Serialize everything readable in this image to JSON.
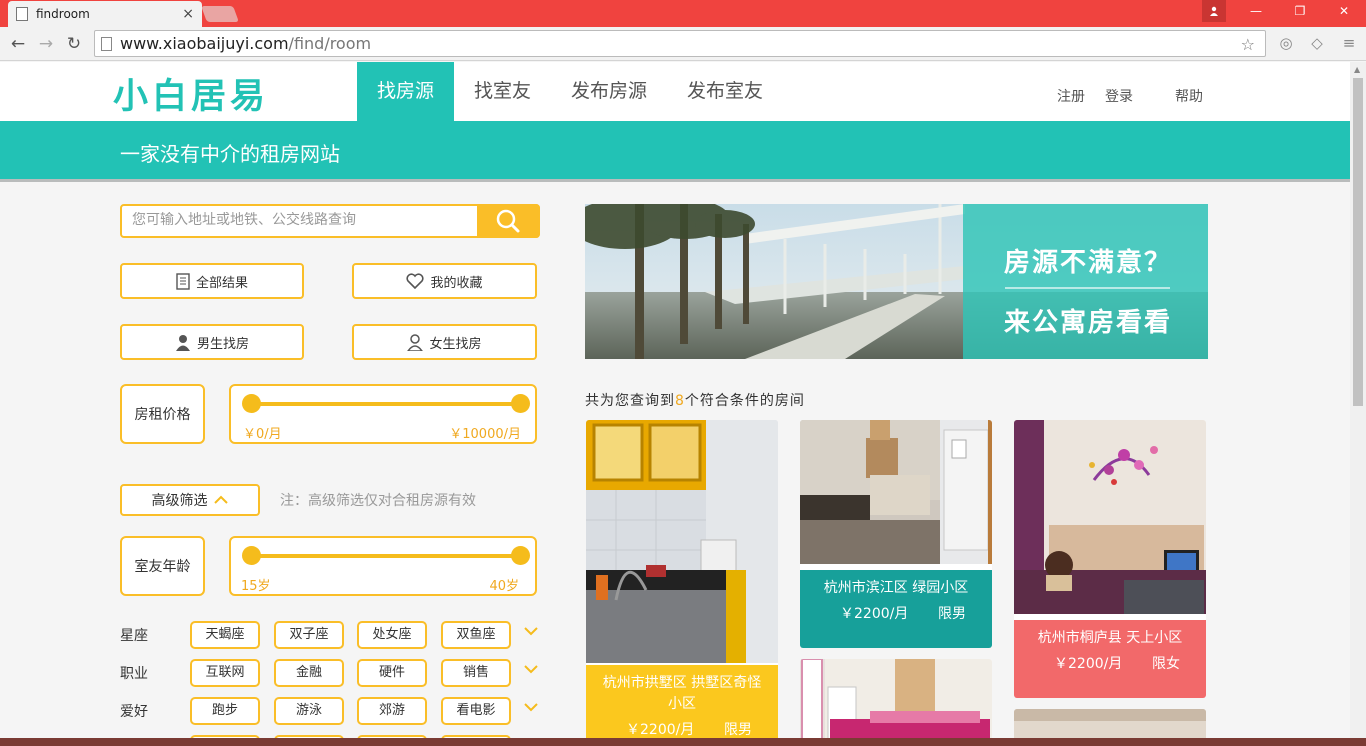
{
  "browser": {
    "tab_title": "findroom",
    "tab_close": "×",
    "url_host": "www.xiaobaijuyi.com",
    "url_path": "/find/room",
    "win_minimize": "—",
    "win_restore": "❐",
    "win_close": "✕"
  },
  "site": {
    "logo": "小白居易",
    "nav": [
      "找房源",
      "找室友",
      "发布房源",
      "发布室友"
    ],
    "register": "注册",
    "login": "登录",
    "help": "帮助",
    "tagline": "一家没有中介的租房网站"
  },
  "filters": {
    "search_placeholder": "您可输入地址或地铁、公交线路查询",
    "all_results": "全部结果",
    "my_favorites": "我的收藏",
    "male_search": "男生找房",
    "female_search": "女生找房",
    "rent_label": "房租价格",
    "rent_min": "￥0/月",
    "rent_max": "￥10000/月",
    "rent_low_fraction": 0,
    "rent_high_fraction": 1,
    "advanced": "高级筛选",
    "advanced_note": "注：高级筛选仅对合租房源有效",
    "age_label": "室友年龄",
    "age_min": "15岁",
    "age_max": "40岁",
    "rows": [
      {
        "label": "星座",
        "chips": [
          "天蝎座",
          "双子座",
          "处女座",
          "双鱼座"
        ]
      },
      {
        "label": "职业",
        "chips": [
          "互联网",
          "金融",
          "硬件",
          "销售"
        ]
      },
      {
        "label": "爱好",
        "chips": [
          "跑步",
          "游泳",
          "郊游",
          "看电影"
        ]
      }
    ]
  },
  "ad": {
    "line1": "房源不满意？",
    "line2": "来公寓房看看"
  },
  "results": {
    "prefix": "共为您查询到",
    "count": "8",
    "suffix": "个符合条件的房间",
    "cards": [
      {
        "address": "杭州市拱墅区 拱墅区奇怪小区",
        "price": "￥2200/月",
        "gender": "限男",
        "color": "#fbc81e"
      },
      {
        "address": "杭州市滨江区 绿园小区",
        "price": "￥2200/月",
        "gender": "限男",
        "color": "#17a09a"
      },
      {
        "address": "杭州市桐庐县 天上小区",
        "price": "￥2200/月",
        "gender": "限女",
        "color": "#f2696a"
      }
    ]
  }
}
